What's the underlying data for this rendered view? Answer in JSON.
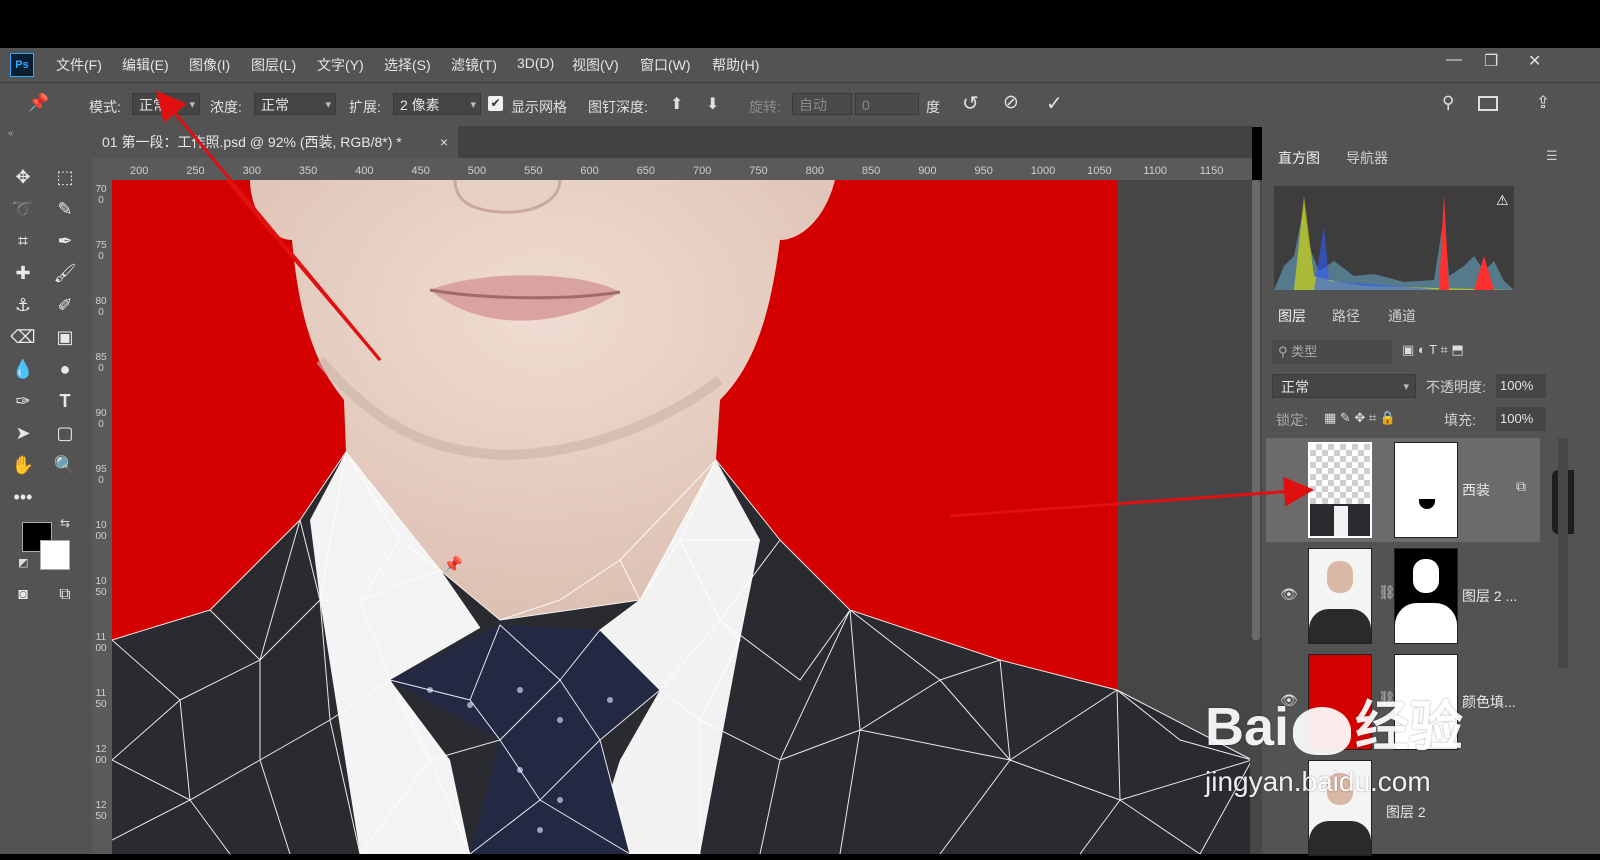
{
  "app": {
    "logo": "Ps"
  },
  "menu": {
    "items": [
      "文件(F)",
      "编辑(E)",
      "图像(I)",
      "图层(L)",
      "文字(Y)",
      "选择(S)",
      "滤镜(T)",
      "3D(D)",
      "视图(V)",
      "窗口(W)",
      "帮助(H)"
    ]
  },
  "window_controls": {
    "minimize": "—",
    "restore": "❐",
    "close": "✕"
  },
  "options": {
    "mode_label": "模式:",
    "mode_value": "正常",
    "density_label": "浓度:",
    "density_value": "正常",
    "expand_label": "扩展:",
    "expand_value": "2 像素",
    "show_mesh_label": "显示网格",
    "show_mesh_checked": true,
    "pin_depth_label": "图钉深度:",
    "rotate_label": "旋转:",
    "rotate_value": "自动",
    "rotate_degree": "0",
    "degree_unit": "度"
  },
  "document": {
    "tab_title": "01 第一段：工作照.psd @ 92% (西装, RGB/8*) *",
    "close": "×"
  },
  "rulers": {
    "horizontal": [
      "200",
      "250",
      "300",
      "350",
      "400",
      "450",
      "500",
      "550",
      "600",
      "650",
      "700",
      "750",
      "800",
      "850",
      "900",
      "950",
      "1000",
      "1050",
      "1100",
      "1150"
    ],
    "vertical": [
      "700",
      "750",
      "800",
      "850",
      "900",
      "950",
      "1000",
      "1050",
      "1100",
      "1150",
      "1200",
      "1250"
    ]
  },
  "panels": {
    "top_tabs": [
      "直方图",
      "导航器"
    ],
    "layer_tabs": [
      "图层",
      "路径",
      "通道"
    ],
    "filter_placeholder": "类型",
    "blend_mode": "正常",
    "opacity_label": "不透明度:",
    "opacity_value": "100%",
    "lock_label": "锁定:",
    "fill_label": "填充:",
    "fill_value": "100%"
  },
  "layers": [
    {
      "name": "西装",
      "visible": false,
      "selected": true
    },
    {
      "name": "图层 2 ...",
      "visible": true,
      "selected": false
    },
    {
      "name": "颜色填...",
      "visible": true,
      "selected": false
    },
    {
      "name": "图层 2",
      "visible": false,
      "selected": false
    }
  ],
  "watermark": {
    "brand": "Bai",
    "brand_suffix": "经验",
    "url": "jingyan.baidu.com"
  },
  "colors": {
    "background_red": "#d40000",
    "annotation_arrow": "#e01010",
    "ps_blue": "#31a8ff"
  }
}
